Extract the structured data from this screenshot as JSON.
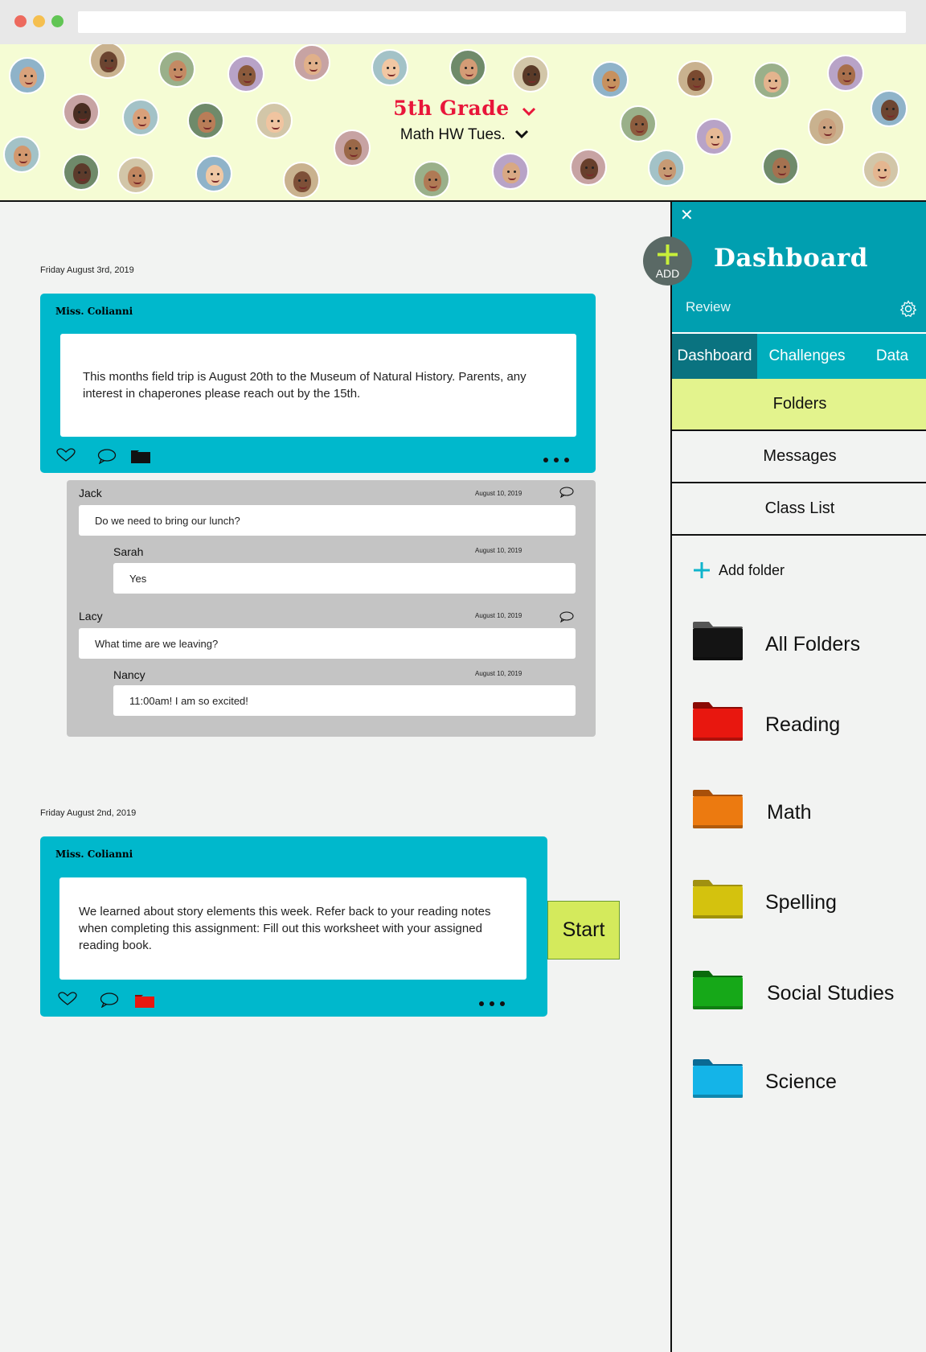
{
  "header": {
    "class_name": "5th Grade",
    "assignment_filter": "Math  HW Tues."
  },
  "avatar_colors": [
    "#d8a27c",
    "#6b4430",
    "#c48a64",
    "#8b5a3c",
    "#e0b08a",
    "#f1c7a3",
    "#d49c76",
    "#5a3a28",
    "#c7915f",
    "#7a4a30",
    "#e3b48e",
    "#a86f4c",
    "#4a2e22",
    "#d9a07a",
    "#b97d58",
    "#f0c4a0",
    "#6d4532",
    "#caa07e",
    "#8c5c3e",
    "#e6b995",
    "#9a6848",
    "#d2986e",
    "#5c3b2b",
    "#c08660",
    "#efc8a4",
    "#7e5038",
    "#b07a55",
    "#d8a884",
    "#683f2c",
    "#c79a74",
    "#a57250",
    "#e4b690"
  ],
  "feed": {
    "posts": [
      {
        "date": "Friday August 3rd, 2019",
        "author": "Miss. Colianni",
        "body": "This months field trip is August 20th to the  Museum of  Natural  History.  Parents, any interest in chaperones please reach out by the 15th."
      },
      {
        "date": "Friday August 2nd, 2019",
        "author": "Miss. Colianni",
        "body": "We learned about story elements this week.  Refer back to your reading notes when completing this assignment:  Fill out this worksheet with your assigned reading book."
      }
    ],
    "replies": [
      {
        "name": "Jack",
        "date": "August 10, 2019",
        "text": "Do we need to bring our lunch?"
      },
      {
        "name": "Sarah",
        "date": "August 10, 2019",
        "text": "Yes"
      },
      {
        "name": "Lacy",
        "date": "August 10, 2019",
        "text": "What time are we leaving?"
      },
      {
        "name": "Nancy",
        "date": "August 10, 2019",
        "text": "11:00am!  I am so excited!"
      }
    ],
    "start_label": "Start"
  },
  "panel": {
    "close_symbol": "✕",
    "add_label": "ADD",
    "title": "Dashboard",
    "review_label": "Review",
    "tabs": [
      "Dashboard",
      "Challenges",
      "Data"
    ],
    "menu": [
      "Folders",
      "Messages",
      "Class List"
    ],
    "add_folder_label": "Add folder",
    "folders": [
      {
        "name": "All Folders",
        "color": "#141414",
        "tab": "#555555"
      },
      {
        "name": "Reading",
        "color": "#e8170f",
        "tab": "#8a0a05"
      },
      {
        "name": "Math",
        "color": "#ec7a10",
        "tab": "#a8500a"
      },
      {
        "name": "Spelling",
        "color": "#d4c20e",
        "tab": "#a09010"
      },
      {
        "name": "Social Studies",
        "color": "#16a818",
        "tab": "#0a6a0c"
      },
      {
        "name": "Science",
        "color": "#14b4e8",
        "tab": "#0a6a94"
      }
    ]
  },
  "colors": {
    "post_bg": "#00b8cc",
    "panel_head": "#009fb0",
    "active_tab": "#0a7380",
    "active_menu": "#e3f38d",
    "grade_red": "#e8163a",
    "banner_bg": "#f5fcd4"
  }
}
